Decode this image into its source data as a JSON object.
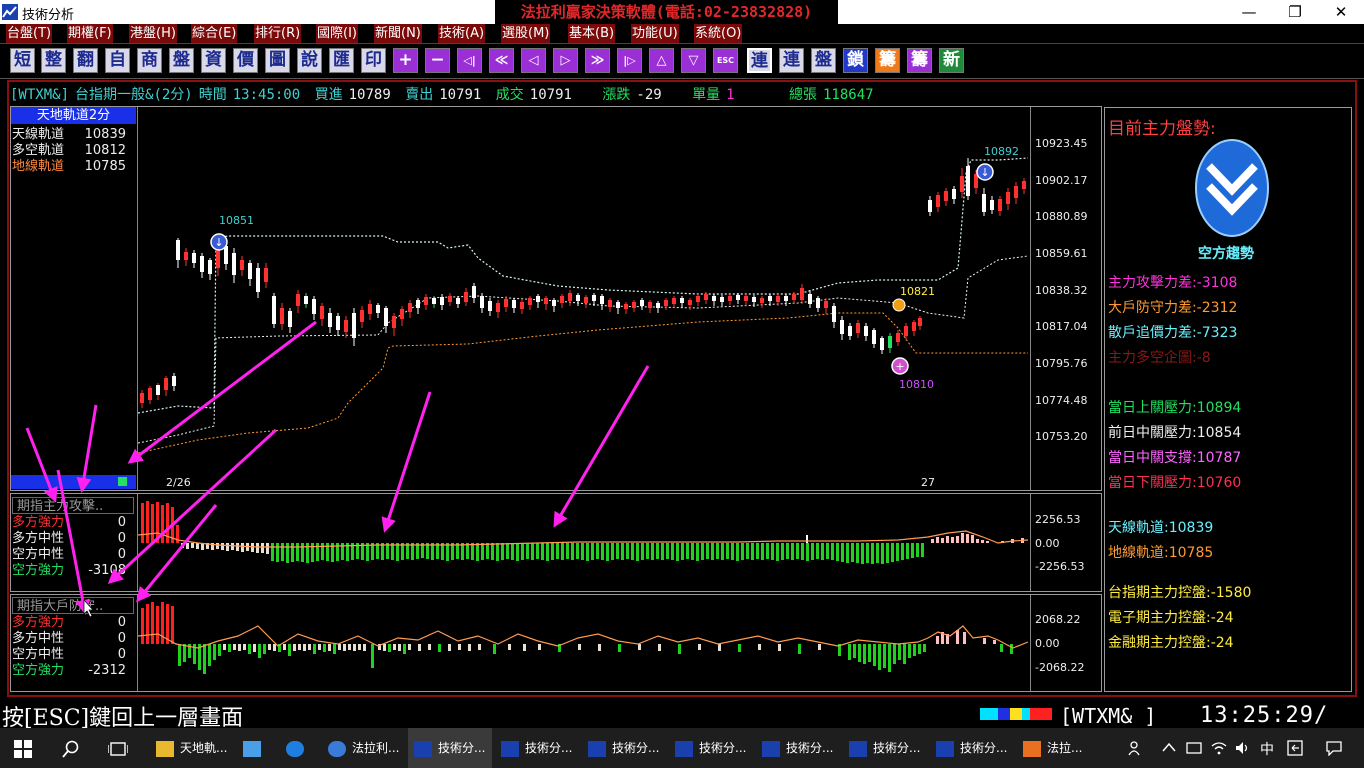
{
  "window": {
    "title": "技術分析",
    "promo_text": "法拉利贏家決策軟體(電話:02-23832828)",
    "minimize": "—",
    "restore": "❐",
    "close": "✕"
  },
  "menu": [
    "台盤(T)",
    "期權(F)",
    "港盤(H)",
    "綜合(E)",
    "排行(R)",
    "國際(I)",
    "新聞(N)",
    "技術(A)",
    "選股(M)",
    "基本(B)",
    "功能(U)",
    "系統(O)"
  ],
  "toolbar": [
    "短",
    "整",
    "翻",
    "自",
    "商",
    "盤",
    "資",
    "價",
    "圖",
    "說",
    "匯",
    "印",
    "+",
    "−",
    "◁|",
    "≪",
    "◁",
    "▷",
    "≫",
    "|▷",
    "△",
    "▽",
    "ESC",
    "連",
    "連",
    "盤",
    "鎖",
    "籌",
    "籌",
    "新"
  ],
  "quote": {
    "symbol": "[WTXM&]",
    "name": "台指期一般&(2分)",
    "time_label": "時間",
    "time": "13:45:00",
    "bid_label": "買進",
    "bid": "10789",
    "ask_label": "賣出",
    "ask": "10791",
    "trade_label": "成交",
    "trade": "10791",
    "change_label": "漲跌",
    "change": "-29",
    "volume_label": "單量",
    "volume": "1",
    "total_label": "總張",
    "total": "118647"
  },
  "legend": {
    "title": "天地軌道2分",
    "rows": [
      {
        "label": "天線軌道",
        "value": "10839"
      },
      {
        "label": "多空軌道",
        "value": "10812"
      },
      {
        "label": "地線軌道",
        "value": "10785"
      }
    ]
  },
  "price_axis": [
    "10923.45",
    "10902.17",
    "10880.89",
    "10859.61",
    "10838.32",
    "10817.04",
    "10795.76",
    "10774.48",
    "10753.20"
  ],
  "date_labels": [
    "2/26",
    "27"
  ],
  "annotations": {
    "high1": "10851",
    "high2": "10892",
    "mid": "10821",
    "low": "10810"
  },
  "sub1": {
    "title": "期指主力攻擊..",
    "rows": [
      {
        "label": "多方強力",
        "value": "0"
      },
      {
        "label": "多方中性",
        "value": "0"
      },
      {
        "label": "空方中性",
        "value": "0"
      },
      {
        "label": "空方強力",
        "value": "-3108"
      }
    ],
    "axis": [
      "2256.53",
      "0.00",
      "-2256.53"
    ]
  },
  "sub2": {
    "title": "期指大戶防守..",
    "rows": [
      {
        "label": "多方強力",
        "value": "0"
      },
      {
        "label": "多方中性",
        "value": "0"
      },
      {
        "label": "空方中性",
        "value": "0"
      },
      {
        "label": "空方強力",
        "value": "-2312"
      }
    ],
    "axis": [
      "2068.22",
      "0.00",
      "-2068.22"
    ]
  },
  "info": {
    "heading": "目前主力盤勢:",
    "trend_label": "空方趨勢",
    "attack_label": "主力攻擊力差:",
    "attack": "-3108",
    "defend_label": "大戶防守力差:",
    "defend": "-2312",
    "retail_label": "散戶追價力差:",
    "retail": "-7323",
    "position_label": "主力多空企圖:",
    "position": "-8",
    "upper_label": "當日上關壓力:",
    "upper": "10894",
    "prev_mid_label": "前日中關壓力:",
    "prev_mid": "10854",
    "mid_support_label": "當日中關支撐:",
    "mid_support": "10787",
    "lower_label": "當日下關壓力:",
    "lower": "10760",
    "sky_label": "天線軌道:",
    "sky": "10839",
    "ground_label": "地線軌道:",
    "ground": "10785",
    "tx_label": "台指期主力控盤:",
    "tx": "-1580",
    "te_label": "電子期主力控盤:",
    "te": "-24",
    "tf_label": "金融期主力控盤:",
    "tf": "-24"
  },
  "status": {
    "esc_hint": "按[ESC]鍵回上一層畫面",
    "code": "[WTXM&  ]",
    "clock": "13:25:29/"
  },
  "taskbar": {
    "items": [
      "天地軌...",
      "",
      "",
      "法拉利...",
      "技術分...",
      "技術分...",
      "技術分...",
      "技術分...",
      "技術分...",
      "技術分...",
      "技術分...",
      "法拉..."
    ],
    "ime": "中"
  }
}
